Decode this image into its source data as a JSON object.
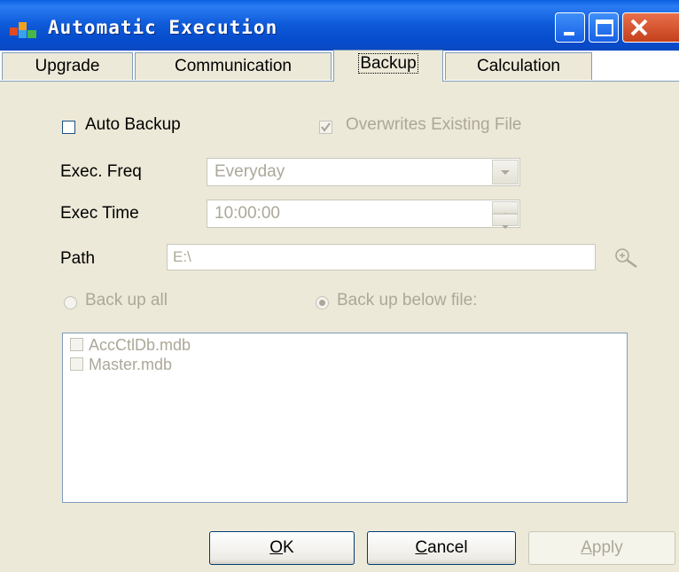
{
  "window": {
    "title": "Automatic Execution",
    "controls": [
      "minimize-icon",
      "maximize-icon",
      "close-icon"
    ]
  },
  "tabs": [
    {
      "label": "Upgrade",
      "active": false
    },
    {
      "label": "Communication",
      "active": false
    },
    {
      "label": "Backup",
      "active": true
    },
    {
      "label": "Calculation",
      "active": false
    }
  ],
  "backup": {
    "auto_backup_label": "Auto Backup",
    "auto_backup_checked": false,
    "overwrite_label": "Overwrites Existing File",
    "overwrite_checked": true,
    "exec_freq_label": "Exec. Freq",
    "exec_freq_value": "Everyday",
    "exec_time_label": "Exec Time",
    "exec_time_value": "10:00:00",
    "path_label": "Path",
    "path_value": "E:\\",
    "backup_all_label": "Back up all",
    "backup_below_label": "Back up below file:",
    "selected_mode": "Back up below file:",
    "files": [
      {
        "name": "AccCtlDb.mdb",
        "checked": false
      },
      {
        "name": "Master.mdb",
        "checked": false
      }
    ]
  },
  "buttons": {
    "ok_accel": "O",
    "ok_rest": "K",
    "cancel_accel": "C",
    "cancel_rest": "ancel",
    "apply_accel": "A",
    "apply_rest": "pply"
  },
  "colors": {
    "titlebar": "#0a5fe0",
    "dialog_bg": "#ece9d8",
    "disabled_text": "#aca899",
    "border": "#7f9db9"
  }
}
